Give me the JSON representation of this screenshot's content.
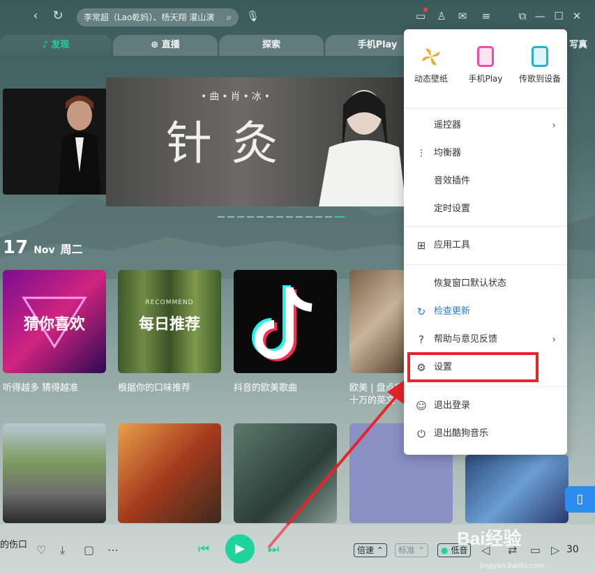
{
  "search": {
    "placeholder": "李常超（Lao乾妈）、杨天翔 灌山演"
  },
  "titlebar": {
    "icons": [
      "back-icon",
      "refresh-icon",
      "mic-icon",
      "monitor-icon",
      "shirt-icon",
      "mail-icon",
      "menu-icon",
      "mini-mode-icon",
      "minimize-icon",
      "maximize-icon",
      "close-icon"
    ]
  },
  "tabs": [
    {
      "label": "发现",
      "icon": "music-note"
    },
    {
      "label": "直播",
      "icon": "record"
    },
    {
      "label": "探索"
    },
    {
      "label": "手机Play"
    },
    {
      "label": "写真"
    }
  ],
  "banner": {
    "subtitle": "•曲•肖•冰•",
    "title": "针灸"
  },
  "date": {
    "day": "17",
    "month": "Nov",
    "weekday": "周二"
  },
  "cards": [
    {
      "text": "猜你喜欢",
      "label": "听得越多 猜得越准"
    },
    {
      "text": "每日推荐",
      "sub": "RECOMMEND",
      "label": "根据你的口味推荐"
    },
    {
      "text": "",
      "label": "抖音的欧美歌曲"
    },
    {
      "text": "",
      "label": "欧美 | 盘点播",
      "label2": "十万的英文"
    }
  ],
  "menu": {
    "quick": [
      {
        "label": "动态壁纸",
        "color": "#f5a623"
      },
      {
        "label": "手机Play",
        "color": "#e94fa5"
      },
      {
        "label": "传歌到设备",
        "color": "#21b3c8"
      }
    ],
    "groups": [
      [
        {
          "label": "遥控器",
          "icon": "",
          "chevron": true
        },
        {
          "label": "均衡器",
          "icon": "equalizer-icon"
        },
        {
          "label": "音效插件",
          "icon": ""
        },
        {
          "label": "定时设置",
          "icon": ""
        }
      ],
      [
        {
          "label": "应用工具",
          "icon": "apps-icon"
        }
      ],
      [
        {
          "label": "恢复窗口默认状态",
          "icon": ""
        },
        {
          "label": "检查更新",
          "icon": "update-icon",
          "highlight": true
        },
        {
          "label": "帮助与意见反馈",
          "icon": "help-icon",
          "chevron": true
        },
        {
          "label": "设置",
          "icon": "gear-icon"
        }
      ],
      [
        {
          "label": "退出登录",
          "icon": "user-icon"
        },
        {
          "label": "退出酷狗音乐",
          "icon": "power-icon"
        }
      ]
    ]
  },
  "player": {
    "song_fragment": "的伤口",
    "speed_label": "倍速",
    "quality_label": "标准",
    "effect_label": "低音",
    "volume": "30"
  },
  "watermark": {
    "text": "Bai经验",
    "sub": "jingyan.baidu.com"
  }
}
